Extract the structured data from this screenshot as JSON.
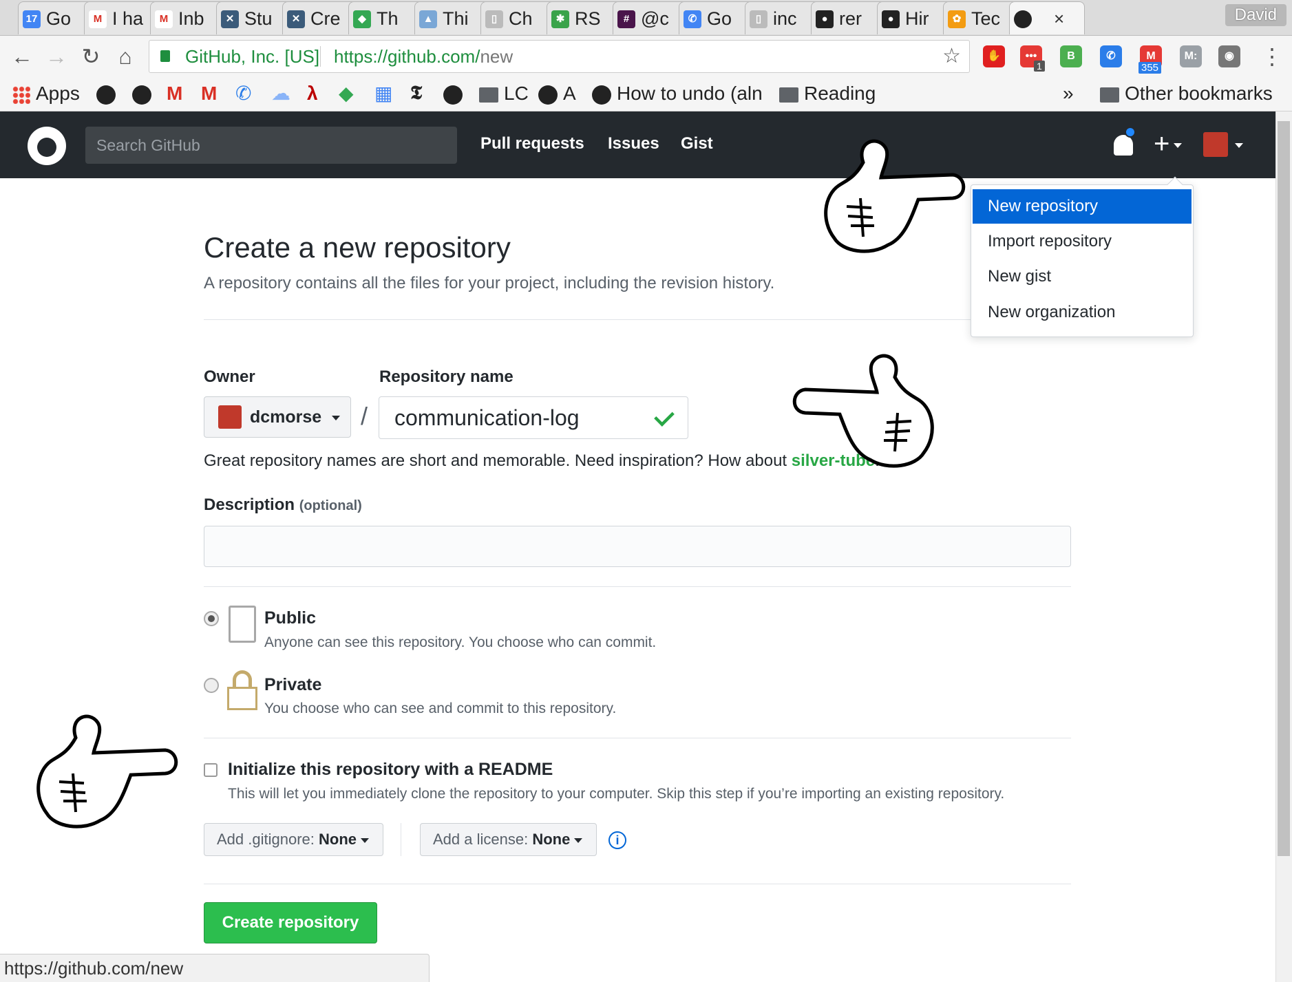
{
  "browser": {
    "tabs": [
      {
        "title": "Go",
        "color": "#4285f4",
        "icon": "17"
      },
      {
        "title": "I ha",
        "color": "#ffffff",
        "icon": "M"
      },
      {
        "title": "Inb",
        "color": "#ffffff",
        "icon": "M"
      },
      {
        "title": "Stu",
        "color": "#3b5b7a",
        "icon": "✕"
      },
      {
        "title": "Cre",
        "color": "#3b5b7a",
        "icon": "✕"
      },
      {
        "title": "Th",
        "color": "#34a853",
        "icon": "◆"
      },
      {
        "title": "Thi",
        "color": "#7aa7d6",
        "icon": "▲"
      },
      {
        "title": "Ch",
        "color": "#bbbbbb",
        "icon": "▯"
      },
      {
        "title": "RS",
        "color": "#3aa34a",
        "icon": "✱"
      },
      {
        "title": "@c",
        "color": "#4a154b",
        "icon": "#"
      },
      {
        "title": "Go",
        "color": "#4285f4",
        "icon": "✆"
      },
      {
        "title": "inc",
        "color": "#bbbbbb",
        "icon": "▯"
      },
      {
        "title": "rer",
        "color": "#222222",
        "icon": "●"
      },
      {
        "title": "Hir",
        "color": "#222222",
        "icon": "●"
      },
      {
        "title": "Tec",
        "color": "#f39c12",
        "icon": "✿"
      }
    ],
    "active_tab_close": "×",
    "user": "David",
    "address": {
      "org": "GitHub, Inc. [US]",
      "url_host": "https://github.com/",
      "url_path": "new"
    },
    "extensions": [
      {
        "name": "adblock-icon",
        "color": "#e02020",
        "label": "✋"
      },
      {
        "name": "more-icon",
        "color": "#e53935",
        "label": "•••"
      },
      {
        "name": "b-icon",
        "color": "#4caf50",
        "label": "B"
      },
      {
        "name": "phone-icon",
        "color": "#2b7de9",
        "label": "✆"
      },
      {
        "name": "gmail-icon",
        "color": "#e53935",
        "label": "M"
      },
      {
        "name": "m-icon",
        "color": "#9aa0a6",
        "label": "M:"
      },
      {
        "name": "camera-icon",
        "color": "#777777",
        "label": "◉"
      }
    ],
    "badges": {
      "more": "1",
      "gmail": "355"
    },
    "bookmarks": {
      "apps": "Apps",
      "lc": "LC",
      "a": "A",
      "how_to_undo": "How to undo (aln",
      "reading": "Reading",
      "overflow": "»",
      "other": "Other bookmarks"
    },
    "status_url": "https://github.com/new"
  },
  "github": {
    "search_placeholder": "Search GitHub",
    "nav": [
      "Pull requests",
      "Issues",
      "Gist"
    ],
    "dropdown": [
      "New repository",
      "Import repository",
      "New gist",
      "New organization"
    ]
  },
  "form": {
    "title": "Create a new repository",
    "subtitle": "A repository contains all the files for your project, including the revision history.",
    "owner_label": "Owner",
    "owner_value": "dcmorse",
    "repo_label": "Repository name",
    "repo_value": "communication-log",
    "slash": "/",
    "hint_text": "Great repository names are short and memorable. Need inspiration? How about ",
    "hint_suggestion": "silver-tube",
    "hint_end": ".",
    "description_label": "Description",
    "description_optional": "(optional)",
    "public_name": "Public",
    "public_desc": "Anyone can see this repository. You choose who can commit.",
    "private_name": "Private",
    "private_desc": "You choose who can see and commit to this repository.",
    "readme_label": "Initialize this repository with a README",
    "readme_desc": "This will let you immediately clone the repository to your computer. Skip this step if you’re importing an existing repository.",
    "gitignore_prefix": "Add .gitignore:",
    "gitignore_value": "None",
    "license_prefix": "Add a license:",
    "license_value": "None",
    "info": "i",
    "create_button": "Create repository"
  }
}
